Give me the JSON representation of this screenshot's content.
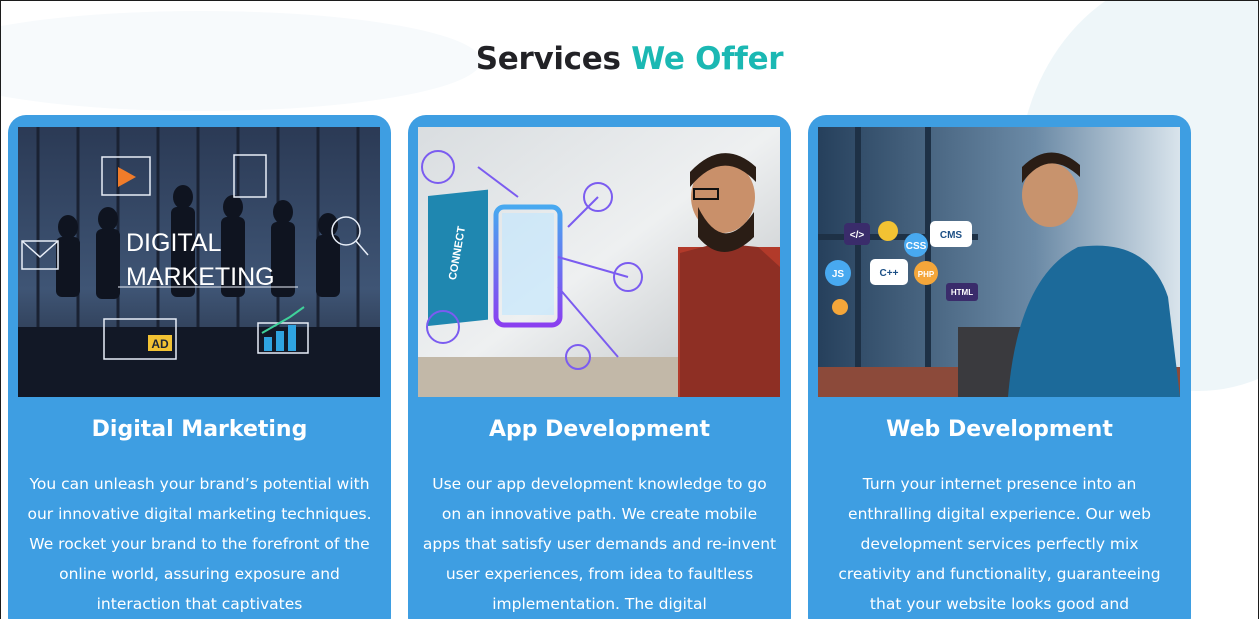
{
  "header": {
    "title_part1": "Services",
    "title_part2": "We Offer"
  },
  "colors": {
    "accent": "#1bb8b3",
    "card_bg": "#3e9ee2",
    "heading_dark": "#222226"
  },
  "cards": [
    {
      "title": "Digital Marketing",
      "image_text_line1": "DIGITAL",
      "image_text_line2": "MARKETING",
      "image_badge": "AD",
      "description": "You can unleash your brand’s potential with our innovative digital marketing techniques. We rocket your brand to the forefront of the online world, assuring exposure and interaction that captivates"
    },
    {
      "title": "App Development",
      "image_text": "CONNECT",
      "description": "Use our app development knowledge to go on an innovative path. We create mobile apps that satisfy user demands and re-invent user experiences, from idea to faultless implementation. The digital"
    },
    {
      "title": "Web Development",
      "image_tags": [
        "</>",
        "CSS",
        "CMS",
        "JS",
        "C++",
        "PHP",
        "HTML"
      ],
      "description": "Turn your internet presence into an enthralling digital experience. Our web development services perfectly mix creativity and functionality, guaranteeing that your website looks good and"
    }
  ]
}
